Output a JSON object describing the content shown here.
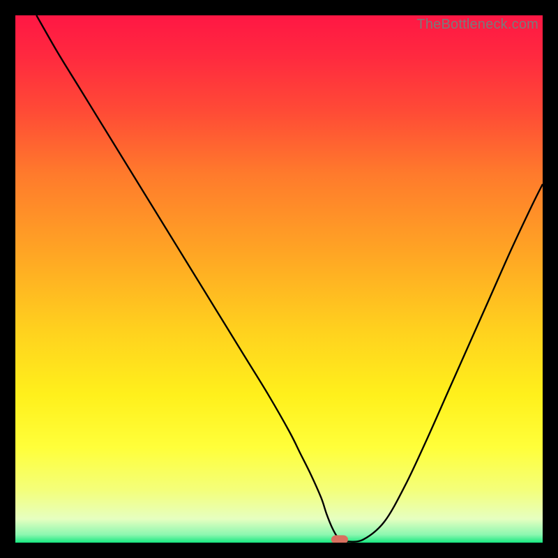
{
  "watermark": "TheBottleneck.com",
  "chart_data": {
    "type": "line",
    "title": "",
    "xlabel": "",
    "ylabel": "",
    "xlim": [
      0,
      100
    ],
    "ylim": [
      0,
      100
    ],
    "grid": false,
    "legend": false,
    "background_gradient": {
      "stops": [
        {
          "pos": 0.0,
          "color": "#ff1744"
        },
        {
          "pos": 0.08,
          "color": "#ff2a3f"
        },
        {
          "pos": 0.18,
          "color": "#ff4a36"
        },
        {
          "pos": 0.3,
          "color": "#ff7a2c"
        },
        {
          "pos": 0.45,
          "color": "#ffa524"
        },
        {
          "pos": 0.6,
          "color": "#ffd21e"
        },
        {
          "pos": 0.72,
          "color": "#fff01c"
        },
        {
          "pos": 0.82,
          "color": "#ffff3a"
        },
        {
          "pos": 0.9,
          "color": "#f4ff7a"
        },
        {
          "pos": 0.955,
          "color": "#e6ffc0"
        },
        {
          "pos": 0.985,
          "color": "#8cf7b0"
        },
        {
          "pos": 1.0,
          "color": "#17e880"
        }
      ]
    },
    "series": [
      {
        "name": "bottleneck-curve",
        "color": "#000000",
        "width": 2.4,
        "x": [
          4,
          8,
          12,
          16,
          20,
          24,
          28,
          32,
          36,
          40,
          44,
          48,
          52,
          54,
          56,
          58,
          59,
          60,
          61,
          62,
          63,
          66,
          70,
          74,
          78,
          82,
          86,
          90,
          94,
          98,
          100
        ],
        "y": [
          100,
          93,
          86.5,
          80,
          73.5,
          67,
          60.5,
          54,
          47.5,
          41,
          34.5,
          28,
          21,
          17,
          13,
          8.5,
          5.5,
          3,
          1.2,
          0.4,
          0.2,
          0.6,
          4,
          11,
          19.5,
          28.5,
          37.5,
          46.5,
          55.5,
          64,
          68
        ]
      }
    ],
    "marker": {
      "name": "bottleneck-marker",
      "x": 61.5,
      "y": 0.6,
      "w": 3.2,
      "h": 1.6,
      "rx": 0.9,
      "color": "#d9705f"
    }
  }
}
